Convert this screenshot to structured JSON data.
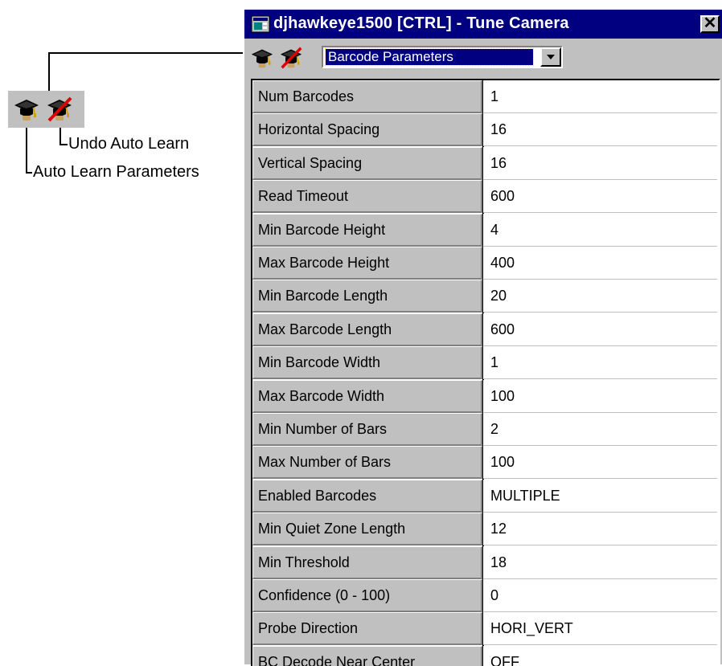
{
  "callout": {
    "undo_label": "Undo Auto Learn",
    "auto_label": "Auto Learn Parameters"
  },
  "window": {
    "title": "djhawkeye1500 [CTRL] - Tune Camera",
    "close_glyph": "✕"
  },
  "toolbar": {
    "auto_learn_icon": "graduation-cap-icon",
    "undo_auto_learn_icon": "graduation-cap-crossed-icon",
    "dropdown_value": "Barcode Parameters"
  },
  "parameters": [
    {
      "name": "Num Barcodes",
      "value": "1"
    },
    {
      "name": "Horizontal Spacing",
      "value": "16"
    },
    {
      "name": "Vertical Spacing",
      "value": "16"
    },
    {
      "name": "Read Timeout",
      "value": "600"
    },
    {
      "name": "Min Barcode Height",
      "value": "4"
    },
    {
      "name": "Max Barcode Height",
      "value": "400"
    },
    {
      "name": "Min Barcode Length",
      "value": "20"
    },
    {
      "name": "Max Barcode Length",
      "value": "600"
    },
    {
      "name": "Min Barcode Width",
      "value": "1"
    },
    {
      "name": "Max Barcode Width",
      "value": "100"
    },
    {
      "name": "Min Number of Bars",
      "value": "2"
    },
    {
      "name": "Max Number of Bars",
      "value": "100"
    },
    {
      "name": "Enabled Barcodes",
      "value": "MULTIPLE"
    },
    {
      "name": "Min Quiet Zone Length",
      "value": "12"
    },
    {
      "name": "Min Threshold",
      "value": "18"
    },
    {
      "name": "Confidence (0 - 100)",
      "value": "0"
    },
    {
      "name": "Probe Direction",
      "value": "HORI_VERT"
    },
    {
      "name": "BC Decode Near Center",
      "value": "OFF"
    }
  ],
  "colors": {
    "titlebar": "#000080",
    "face": "#c0c0c0",
    "undo_slash": "#e00000"
  }
}
